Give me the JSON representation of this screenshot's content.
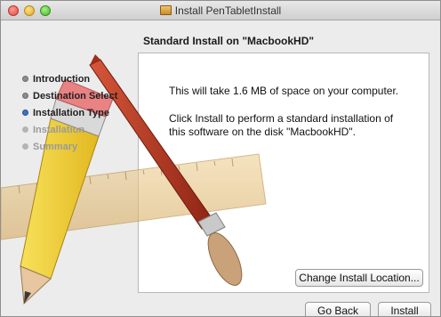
{
  "window": {
    "title": "Install PenTabletInstall"
  },
  "heading": "Standard Install on \"MacbookHD\"",
  "sidebar": {
    "steps": [
      {
        "label": "Introduction",
        "state": "done"
      },
      {
        "label": "Destination Select",
        "state": "done"
      },
      {
        "label": "Installation Type",
        "state": "current"
      },
      {
        "label": "Installation",
        "state": "pending"
      },
      {
        "label": "Summary",
        "state": "pending"
      }
    ]
  },
  "content": {
    "space_message": "This will take 1.6 MB of space on your computer.",
    "install_message_line1": "Click Install to perform a standard installation of",
    "install_message_line2": "this software on the disk \"MacbookHD\"."
  },
  "buttons": {
    "change_location": "Change Install Location...",
    "go_back": "Go Back",
    "install": "Install"
  },
  "colors": {
    "current_step_bullet": "#3b72c9",
    "pencil_yellow": "#f2d230",
    "brush_red": "#b8321d",
    "ruler_tan": "#e7c27e"
  },
  "icons": {
    "title_icon": "package-icon"
  }
}
